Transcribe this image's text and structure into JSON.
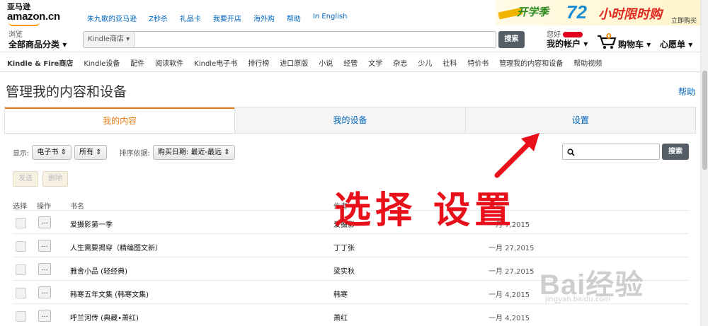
{
  "logo": {
    "cn": "亚马逊",
    "en": "amazon.cn"
  },
  "top_links": [
    "朱九歌的亚马逊",
    "Z秒杀",
    "礼品卡",
    "我要开店",
    "海外购",
    "帮助",
    "In English"
  ],
  "promo": {
    "part1": "开学季",
    "part2": "72",
    "part3": "小时限时购",
    "cta": "立即购买"
  },
  "nav": {
    "dept_line1": "浏览",
    "dept_line2": "全部商品分类",
    "search_category": "Kindle商店",
    "search_button": "搜索",
    "account_line1": "您好",
    "account_line2": "我的帐户",
    "cart_count": "0",
    "cart_label": "购物车",
    "wishlist": "心愿单"
  },
  "subnav": [
    "Kindle & Fire商店",
    "Kindle设备",
    "配件",
    "阅读软件",
    "Kindle电子书",
    "排行榜",
    "进口原版",
    "小说",
    "经管",
    "文学",
    "杂志",
    "少儿",
    "社科",
    "特价书",
    "管理我的内容和设备",
    "帮助视频"
  ],
  "page": {
    "title": "管理我的内容和设备",
    "help": "帮助"
  },
  "tabs": [
    {
      "label": "我的内容",
      "active": true
    },
    {
      "label": "我的设备",
      "active": false
    },
    {
      "label": "设置",
      "active": false
    }
  ],
  "filters": {
    "show_label": "显示:",
    "type_value": "电子书",
    "scope_value": "所有",
    "sort_label": "排序依据:",
    "sort_value": "购买日期: 最近-最远",
    "search_placeholder": "",
    "search_button": "搜索"
  },
  "actions": {
    "send": "发送",
    "delete": "删除"
  },
  "table": {
    "headers": {
      "select": "选择",
      "action": "操作",
      "title": "书名",
      "author": "作者",
      "date": "日期"
    },
    "rows": [
      {
        "title": "爱摄影第一季",
        "author": "爱摄影",
        "date": "一月 7,2015"
      },
      {
        "title": "人生需要揭穿（精编图文新）",
        "author": "丁丁张",
        "date": "一月 27,2015"
      },
      {
        "title": "雅舍小品 (轻经典)",
        "author": "梁实秋",
        "date": "一月 27,2015"
      },
      {
        "title": "韩寒五年文集 (韩寒文集)",
        "author": "韩寒",
        "date": "一月 4,2015"
      },
      {
        "title": "呼兰河传 (典藏•萧红)",
        "author": "萧红",
        "date": "一月 4,2015"
      }
    ],
    "row_button": "..."
  },
  "annotation": {
    "text": "选择 设置",
    "color": "#e8101a"
  },
  "watermark": {
    "main": "Bai经验",
    "sub": "jingyan.baidu.com"
  },
  "colors": {
    "accent": "#e47911",
    "link": "#0066c0",
    "button": "#555d66"
  }
}
